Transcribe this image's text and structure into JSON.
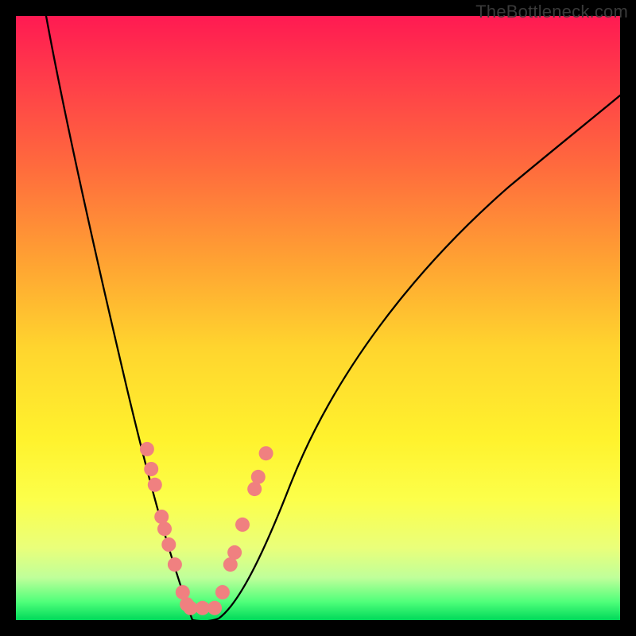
{
  "watermark": "TheBottleneck.com",
  "chart_data": {
    "type": "line",
    "title": "",
    "xlabel": "",
    "ylabel": "",
    "xlim": [
      0,
      100
    ],
    "ylim": [
      0,
      100
    ],
    "gradient_color_stops": [
      {
        "pos": 0,
        "color": "#ff1a52"
      },
      {
        "pos": 25,
        "color": "#ff6b3d"
      },
      {
        "pos": 55,
        "color": "#ffd52e"
      },
      {
        "pos": 80,
        "color": "#fcff4a"
      },
      {
        "pos": 97,
        "color": "#4fff7a"
      },
      {
        "pos": 100,
        "color": "#00d95a"
      }
    ],
    "series": [
      {
        "name": "left_curve",
        "x": [
          5,
          8,
          11,
          14,
          17,
          20,
          23,
          26,
          29
        ],
        "y": [
          100,
          80,
          62,
          47,
          33,
          21,
          12,
          5,
          0
        ]
      },
      {
        "name": "right_curve",
        "x": [
          33,
          36,
          40,
          45,
          50,
          57,
          65,
          75,
          87,
          100
        ],
        "y": [
          0,
          5,
          13,
          23,
          33,
          44,
          55,
          66,
          77,
          88
        ]
      }
    ],
    "scatter_points": [
      {
        "x": 21.7,
        "y": 28.3
      },
      {
        "x": 22.4,
        "y": 25.0
      },
      {
        "x": 23.0,
        "y": 22.4
      },
      {
        "x": 24.1,
        "y": 17.1
      },
      {
        "x": 24.6,
        "y": 15.1
      },
      {
        "x": 25.3,
        "y": 12.5
      },
      {
        "x": 26.3,
        "y": 9.2
      },
      {
        "x": 27.6,
        "y": 4.6
      },
      {
        "x": 28.3,
        "y": 2.6
      },
      {
        "x": 28.9,
        "y": 2.0
      },
      {
        "x": 30.9,
        "y": 2.0
      },
      {
        "x": 32.9,
        "y": 2.0
      },
      {
        "x": 34.2,
        "y": 4.6
      },
      {
        "x": 35.5,
        "y": 9.2
      },
      {
        "x": 36.2,
        "y": 11.2
      },
      {
        "x": 37.5,
        "y": 15.8
      },
      {
        "x": 39.5,
        "y": 21.7
      },
      {
        "x": 40.1,
        "y": 23.7
      },
      {
        "x": 41.4,
        "y": 27.6
      }
    ],
    "marker_color": "#f08080"
  }
}
